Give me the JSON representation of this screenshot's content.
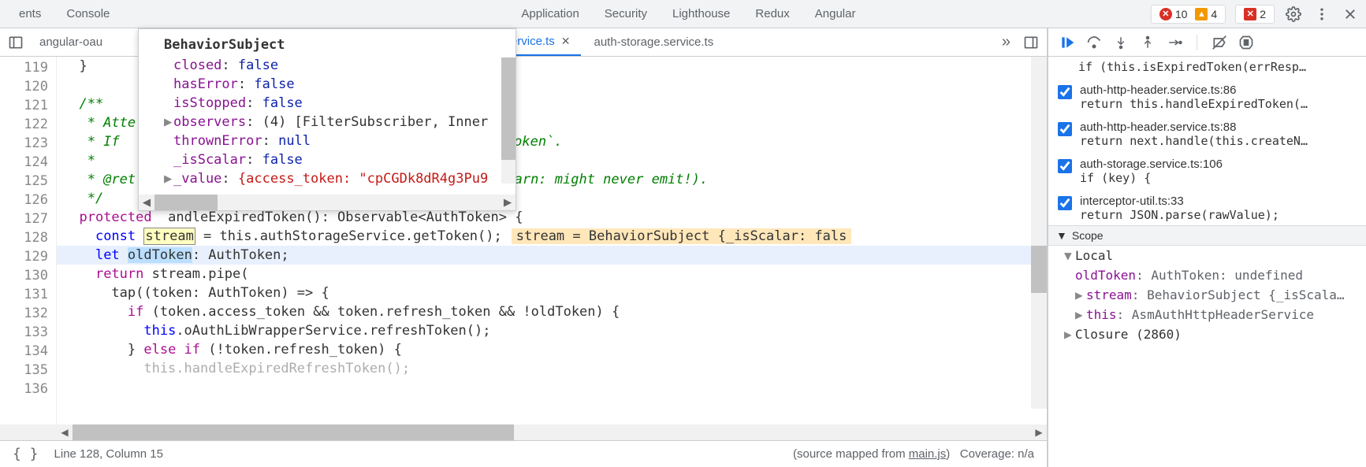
{
  "topbar": {
    "tabs": [
      "ents",
      "Console",
      "Application",
      "Security",
      "Lighthouse",
      "Redux",
      "Angular"
    ],
    "errors": "10",
    "warnings": "4",
    "issues": "2"
  },
  "file_nav": {
    "crumb": "angular-oau",
    "tabs": [
      {
        "label": "r.service.ts",
        "active": true
      },
      {
        "label": "auth-storage.service.ts",
        "active": false
      }
    ]
  },
  "gutter": [
    "119",
    "120",
    "121",
    "122",
    "123",
    "124",
    "125",
    "126",
    "127",
    "128",
    "129",
    "130",
    "131",
    "132",
    "133",
    "134",
    "135",
    "136"
  ],
  "popover": {
    "title": "BehaviorSubject",
    "rows": [
      {
        "expand": "",
        "key": "closed",
        "val": "false",
        "cls": "v-bool"
      },
      {
        "expand": "",
        "key": "hasError",
        "val": "false",
        "cls": "v-bool"
      },
      {
        "expand": "",
        "key": "isStopped",
        "val": "false",
        "cls": "v-bool"
      },
      {
        "expand": "▶",
        "key": "observers",
        "val": "(4) [FilterSubscriber, Inner",
        "cls": ""
      },
      {
        "expand": "",
        "key": "thrownError",
        "val": "null",
        "cls": "v-null"
      },
      {
        "expand": "",
        "key": "_isScalar",
        "val": "false",
        "cls": "v-bool"
      },
      {
        "expand": "▶",
        "key": "_value",
        "val": "{access_token: \"cpCGDk8dR4g3Pu9",
        "cls": "",
        "str": true
      }
    ]
  },
  "code": {
    "l119": "  }",
    "l120": "",
    "l121": "  /**",
    "l122": "   * Atte",
    "l123": "   * If ",
    "l123b": "Token`.",
    "l124": "   *",
    "l125": "   * @ret",
    "l125b": "(Warn: might never emit!).",
    "l126": "   */",
    "l127_kw": "protected",
    "l127_fn": "andleExpiredToken",
    "l127_rest": "(): Observable<AuthToken> {",
    "l128_kw": "const",
    "l128_var": "stream",
    "l128_rest": " = this.authStorageService.getToken();",
    "l128_inline": "stream = BehaviorSubject {_isScalar: fals",
    "l129_kw": "let",
    "l129_var": "oldToken",
    "l129_rest": ": AuthToken;",
    "l130_kw": "return",
    "l130_rest": " stream.pipe(",
    "l131": "      tap((token: AuthToken) => {",
    "l132_kw": "if",
    "l132_rest": " (token.access_token && token.refresh_token && !oldToken) {",
    "l133_kw": "this",
    "l133_rest": ".oAuthLibWrapperService.refreshToken();",
    "l134_else": "else if",
    "l134_rest": " (!token.refresh_token) {",
    "l135": "          this.handleExpiredRefreshToken();",
    "l136": ""
  },
  "debug": {
    "partial_top": "if (this.isExpiredToken(errResp…",
    "breakpoints": [
      {
        "title": "auth-http-header.service.ts:86",
        "code": "return this.handleExpiredToken(…"
      },
      {
        "title": "auth-http-header.service.ts:88",
        "code": "return next.handle(this.createN…"
      },
      {
        "title": "auth-storage.service.ts:106",
        "code": "if (key) {"
      },
      {
        "title": "interceptor-util.ts:33",
        "code": "return JSON.parse(rawValue);"
      }
    ],
    "scope_label": "Scope",
    "local_label": "Local",
    "scope": {
      "oldToken_k": "oldToken",
      "oldToken_t": ": AuthToken",
      "oldToken_v": ": undefined",
      "stream_k": "stream",
      "stream_v": ": BehaviorSubject {_isScala…",
      "this_k": "this",
      "this_v": ": AsmAuthHttpHeaderService",
      "closure": "Closure (2860)"
    }
  },
  "statusbar": {
    "pos": "Line 128, Column 15",
    "mapped_from_label": "(source mapped from ",
    "mapped_from_link": "main.js",
    "mapped_from_close": ")",
    "coverage": "Coverage: n/a"
  }
}
